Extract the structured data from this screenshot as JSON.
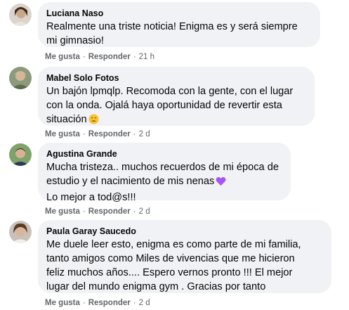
{
  "labels": {
    "like": "Me gusta",
    "reply": "Responder",
    "sep": "·"
  },
  "comments": [
    {
      "author": "Luciana Naso",
      "text": "Realmente una triste noticia! Enigma es y será siempre\nmi gimnasio!",
      "time": "21 h",
      "emoji": ""
    },
    {
      "author": "Mabel Solo Fotos",
      "text": "Un bajón lpmqlp. Recomoda con la gente, con el lugar\ncon la onda. Ojalá haya oportunidad de revertir esta\nsituación",
      "time": "2 d",
      "emoji": "disappointed-face"
    },
    {
      "author": "Agustina Grande",
      "text": "Mucha tristeza.. muchos recuerdos de mi época de\nestudio y el nacimiento de mis nenas",
      "text2": "Lo mejor a tod@s!!!",
      "time": "2 d",
      "emoji": "purple-heart"
    },
    {
      "author": "Paula Garay Saucedo",
      "text": "Me duele leer esto, enigma es como parte de mi familia,\ntanto amigos como Miles de vivencias que me hicieron\nfeliz muchos años.... Espero vernos pronto !!! El mejor\nlugar del mundo enigma gym . Gracias por tanto",
      "time": "2 d",
      "emoji": ""
    }
  ]
}
